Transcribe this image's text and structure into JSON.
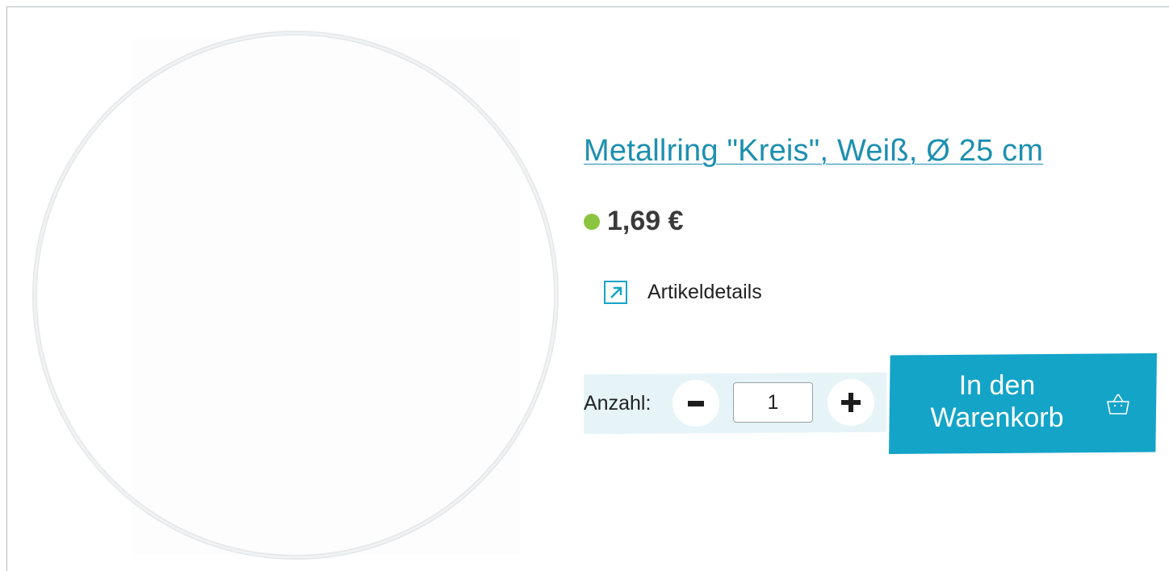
{
  "product": {
    "title": "Metallring \"Kreis\", Weiß, Ø 25 cm",
    "price": "1,69 €",
    "stock_status_color": "#8bc53f",
    "image_icon": "white-metal-ring-image"
  },
  "details_link": {
    "label": "Artikeldetails",
    "icon": "external-arrow-icon"
  },
  "quantity": {
    "label": "Anzahl:",
    "value": "1",
    "decrease_icon": "minus-icon",
    "increase_icon": "plus-icon"
  },
  "cart_button": {
    "line1": "In den",
    "line2": "Warenkorb",
    "icon": "basket-icon"
  },
  "colors": {
    "accent": "#14a4c8",
    "title_link": "#1c8fb0",
    "quantity_panel": "#e6f4f8"
  }
}
